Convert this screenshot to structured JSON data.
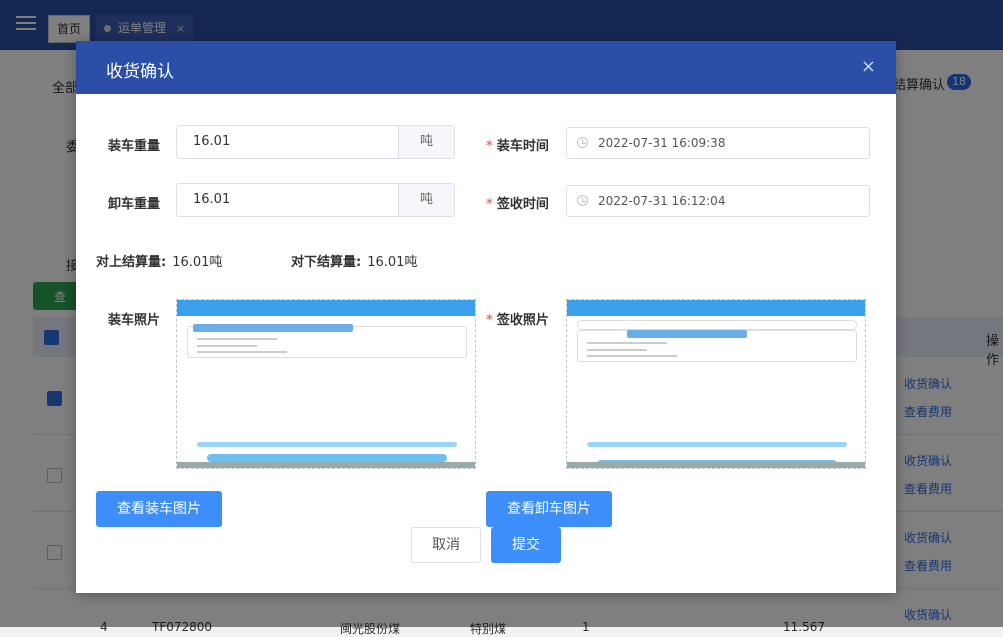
{
  "tabs": {
    "home": "首页",
    "waybill": "运单管理",
    "close": "×"
  },
  "background": {
    "tab_all": "全部",
    "tab_settle": "结算确认",
    "settle_count": "18",
    "label_a": "委",
    "label_b": "接",
    "search_btn": "查",
    "col_action": "操作",
    "row4_no": "4",
    "row4_id": "TF072800",
    "row4_company": "闽光股份煤",
    "row4_type": "特别煤",
    "row4_qty": "1",
    "row4_weight": "11.567",
    "actions": [
      {
        "confirm": "收货确认",
        "fee": "查看费用"
      },
      {
        "confirm": "收货确认",
        "fee": "查看费用"
      },
      {
        "confirm": "收货确认",
        "fee": "查看费用"
      },
      {
        "confirm": "收货确认"
      }
    ]
  },
  "modal": {
    "title": "收货确认",
    "close": "×",
    "load_weight": {
      "label": "装车重量",
      "value": "16.01",
      "unit": "吨"
    },
    "unload_weight": {
      "label": "卸车重量",
      "value": "16.01",
      "unit": "吨"
    },
    "load_time": {
      "label": "装车时间",
      "value": "2022-07-31 16:09:38"
    },
    "sign_time": {
      "label": "签收时间",
      "value": "2022-07-31 16:12:04"
    },
    "settle_up": {
      "label": "对上结算量:",
      "value": "16.01吨"
    },
    "settle_down": {
      "label": "对下结算量:",
      "value": "16.01吨"
    },
    "load_photo_label": "装车照片",
    "sign_photo_label": "签收照片",
    "view_load_btn": "查看装车图片",
    "view_unload_btn": "查看卸车图片",
    "cancel_btn": "取消",
    "submit_btn": "提交",
    "required_mark": "*"
  },
  "colors": {
    "header": "#2b4fa6",
    "primary": "#3d8ef8",
    "required": "#f56c6c"
  }
}
